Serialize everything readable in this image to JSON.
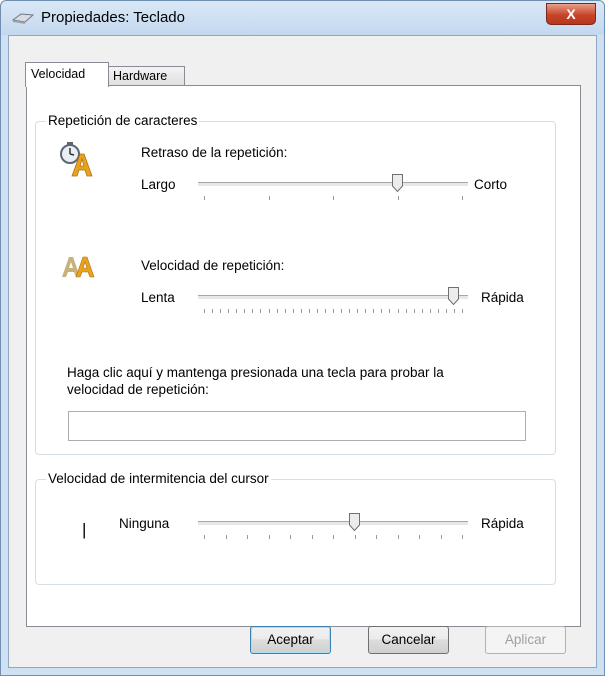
{
  "window": {
    "title": "Propiedades: Teclado",
    "close_label": "X",
    "title_icon": "keyboard-icon"
  },
  "tabs": [
    {
      "label": "Velocidad",
      "active": true
    },
    {
      "label": "Hardware",
      "active": false
    }
  ],
  "repeat_group": {
    "legend": "Repetición de caracteres",
    "delay": {
      "icon": "clock-letter-a-icon",
      "label": "Retraso de la repetición:",
      "min_label": "Largo",
      "max_label": "Corto",
      "position": 3,
      "steps": 4
    },
    "rate": {
      "icon": "double-letter-a-icon",
      "label": "Velocidad de repetición:",
      "min_label": "Lenta",
      "max_label": "Rápida",
      "position": 31,
      "steps": 32
    },
    "test_prompt_line1": "Haga clic aquí y mantenga presionada una tecla para probar la",
    "test_prompt_line2": "velocidad de repetición:",
    "test_value": ""
  },
  "cursor_group": {
    "legend": "Velocidad de intermitencia del cursor",
    "cursor_glyph": "|",
    "min_label": "Ninguna",
    "max_label": "Rápida",
    "position": 7,
    "steps": 12
  },
  "buttons": {
    "ok": "Aceptar",
    "cancel": "Cancelar",
    "apply": "Aplicar"
  }
}
